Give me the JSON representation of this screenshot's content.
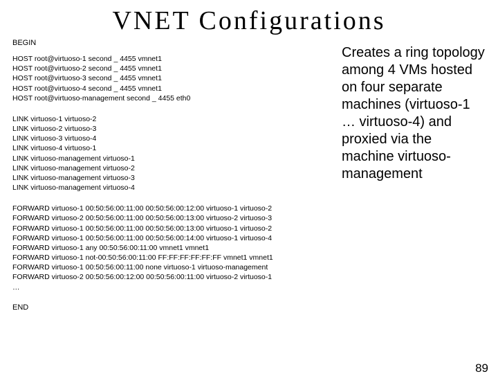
{
  "title": "VNET Configurations",
  "begin_label": "BEGIN",
  "end_label": "END",
  "host_block": [
    "HOST root@virtuoso-1 second _ 4455 vmnet1",
    "HOST root@virtuoso-2 second _ 4455 vmnet1",
    "HOST root@virtuoso-3 second _ 4455 vmnet1",
    "HOST root@virtuoso-4 second _ 4455 vmnet1",
    "HOST root@virtuoso-management second _ 4455 eth0"
  ],
  "link_block": [
    "LINK virtuoso-1 virtuoso-2",
    "LINK virtuoso-2 virtuoso-3",
    "LINK virtuoso-3 virtuoso-4",
    "LINK virtuoso-4 virtuoso-1",
    "LINK virtuoso-management virtuoso-1",
    "LINK virtuoso-management virtuoso-2",
    "LINK virtuoso-management virtuoso-3",
    "LINK virtuoso-management virtuoso-4"
  ],
  "forward_block": [
    "FORWARD virtuoso-1 00:50:56:00:11:00 00:50:56:00:12:00 virtuoso-1  virtuoso-2",
    "FORWARD virtuoso-2 00:50:56:00:11:00 00:50:56:00:13:00 virtuoso-2  virtuoso-3",
    "FORWARD virtuoso-1 00:50:56:00:11:00 00:50:56:00:13:00 virtuoso-1  virtuoso-2",
    "FORWARD virtuoso-1 00:50:56:00:11:00 00:50:56:00:14:00 virtuoso-1  virtuoso-4",
    "FORWARD virtuoso-1 any 00:50:56:00:11:00 vmnet1 vmnet1",
    "FORWARD virtuoso-1 not-00:50:56:00:11:00 FF:FF:FF:FF:FF:FF vmnet1 vmnet1",
    "FORWARD virtuoso-1 00:50:56:00:11:00 none virtuoso-1 virtuoso-management",
    "FORWARD virtuoso-2 00:50:56:00:12:00 00:50:56:00:11:00 virtuoso-2  virtuoso-1",
    "…"
  ],
  "description": "Creates a ring topology among 4 VMs hosted on four separate machines (virtuoso-1 … virtuoso-4) and proxied via the machine virtuoso-management",
  "page_number": "89"
}
